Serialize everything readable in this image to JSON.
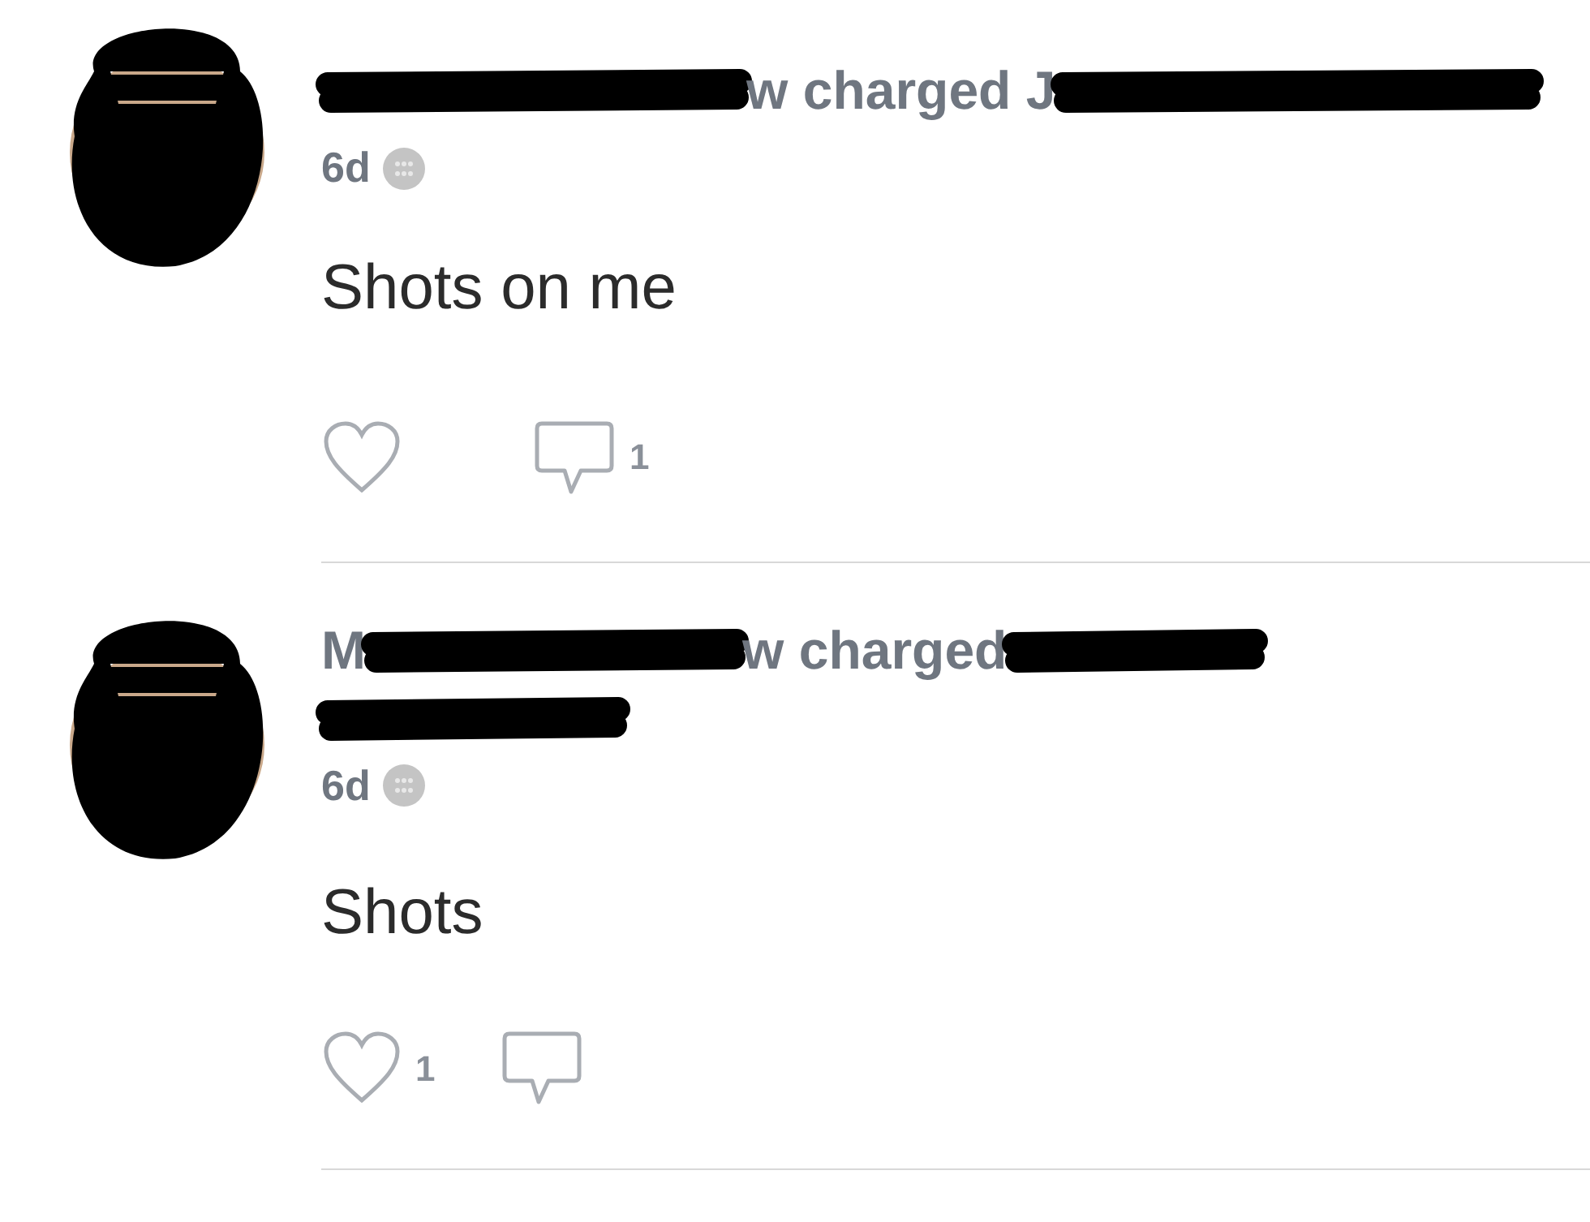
{
  "posts": [
    {
      "header": [
        {
          "kind": "redaction"
        },
        {
          "kind": "text",
          "text": "w charged J"
        },
        {
          "kind": "redaction"
        }
      ],
      "time": "6d",
      "message": "Shots on me",
      "liked": false,
      "comments": "1"
    },
    {
      "header": [
        {
          "kind": "text",
          "text": "M"
        },
        {
          "kind": "redaction"
        },
        {
          "kind": "text",
          "text": "w charged"
        },
        {
          "kind": "redaction"
        },
        {
          "kind": "break"
        },
        {
          "kind": "redaction"
        }
      ],
      "time": "6d",
      "message": "Shots",
      "liked": false,
      "likes": "1"
    }
  ]
}
